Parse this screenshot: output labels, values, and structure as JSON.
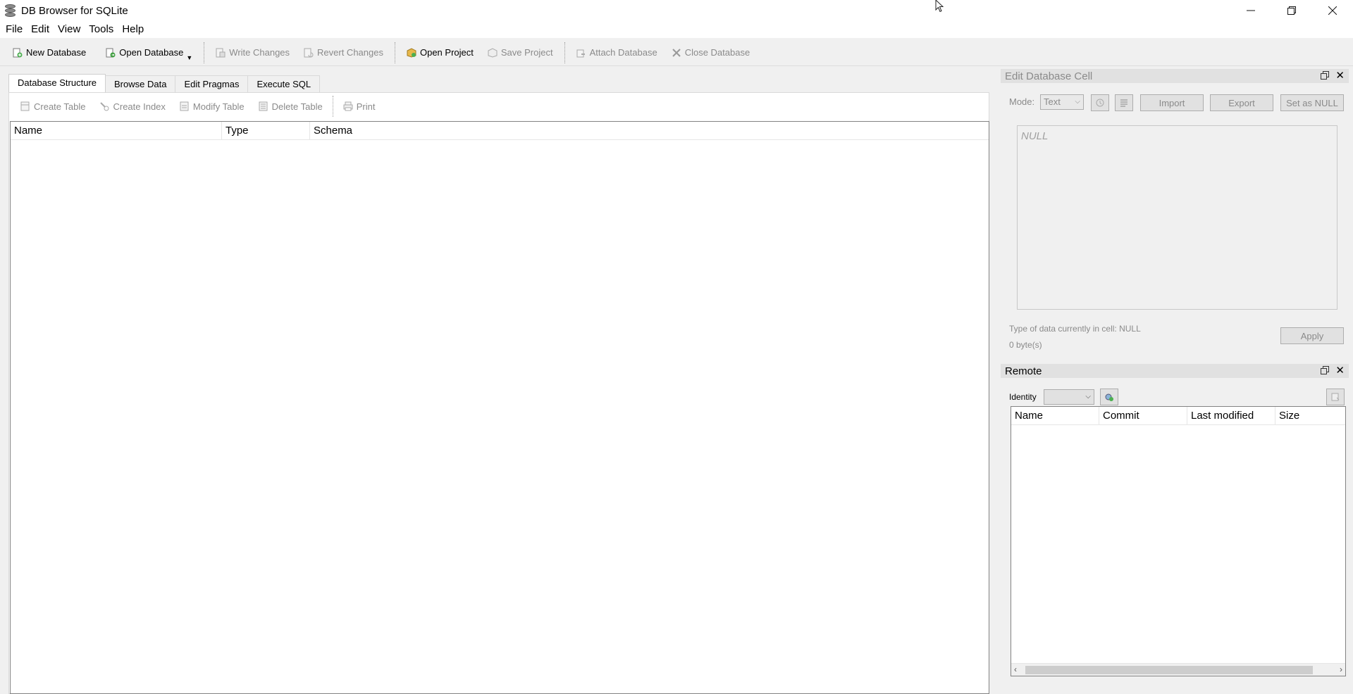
{
  "window": {
    "title": "DB Browser for SQLite"
  },
  "menu": [
    "File",
    "Edit",
    "View",
    "Tools",
    "Help"
  ],
  "toolbar": {
    "new_database": "New Database",
    "open_database": "Open Database",
    "write_changes": "Write Changes",
    "revert_changes": "Revert Changes",
    "open_project": "Open Project",
    "save_project": "Save Project",
    "attach_database": "Attach Database",
    "close_database": "Close Database"
  },
  "tabs": [
    "Database Structure",
    "Browse Data",
    "Edit Pragmas",
    "Execute SQL"
  ],
  "structure": {
    "create_table": "Create Table",
    "create_index": "Create Index",
    "modify_table": "Modify Table",
    "delete_table": "Delete Table",
    "print": "Print",
    "columns": [
      "Name",
      "Type",
      "Schema"
    ]
  },
  "edit_cell": {
    "title": "Edit Database Cell",
    "mode_label": "Mode:",
    "mode_value": "Text",
    "import": "Import",
    "export": "Export",
    "set_null": "Set as NULL",
    "placeholder": "NULL",
    "type_info": "Type of data currently in cell: NULL",
    "size_info": "0 byte(s)",
    "apply": "Apply"
  },
  "remote": {
    "title": "Remote",
    "identity_label": "Identity",
    "columns": [
      "Name",
      "Commit",
      "Last modified",
      "Size"
    ]
  },
  "colors": {
    "window_bg": "#f0f0f0",
    "dock_title_bg": "#e1e1e1",
    "disabled_text": "#8a8a8a"
  }
}
